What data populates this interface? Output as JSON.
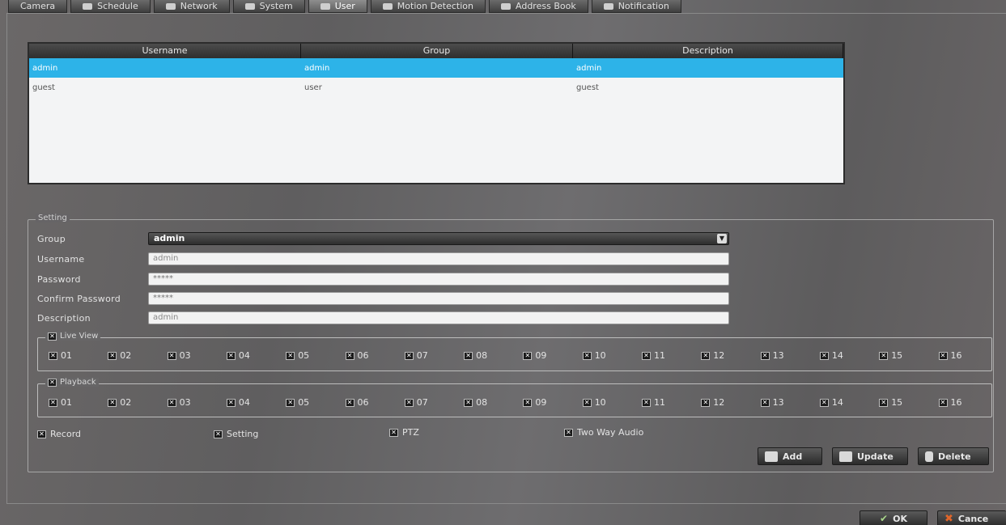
{
  "tabs": [
    {
      "label": "Camera"
    },
    {
      "label": "Schedule"
    },
    {
      "label": "Network"
    },
    {
      "label": "System"
    },
    {
      "label": "User"
    },
    {
      "label": "Motion Detection"
    },
    {
      "label": "Address Book"
    },
    {
      "label": "Notification"
    }
  ],
  "users_table": {
    "headers": [
      "Username",
      "Group",
      "Description"
    ],
    "rows": [
      {
        "username": "admin",
        "group": "admin",
        "description": "admin"
      },
      {
        "username": "guest",
        "group": "user",
        "description": "guest"
      }
    ]
  },
  "setting": {
    "title": "Setting",
    "group_label": "Group",
    "group_value": "admin",
    "username_label": "Username",
    "username_value": "admin",
    "password_label": "Password",
    "password_value": "*****",
    "confirm_label": "Confirm Password",
    "confirm_value": "*****",
    "description_label": "Description",
    "description_value": "admin",
    "live_view_label": "Live View",
    "playback_label": "Playback",
    "checkbox_mark": "✕",
    "channels": [
      "01",
      "02",
      "03",
      "04",
      "05",
      "06",
      "07",
      "08",
      "09",
      "10",
      "11",
      "12",
      "13",
      "14",
      "15",
      "16"
    ],
    "permissions": [
      "Record",
      "Setting",
      "PTZ",
      "Two Way Audio"
    ]
  },
  "buttons": {
    "add": "Add",
    "update": "Update",
    "delete": "Delete",
    "ok": "OK",
    "cancel": "Cance"
  }
}
